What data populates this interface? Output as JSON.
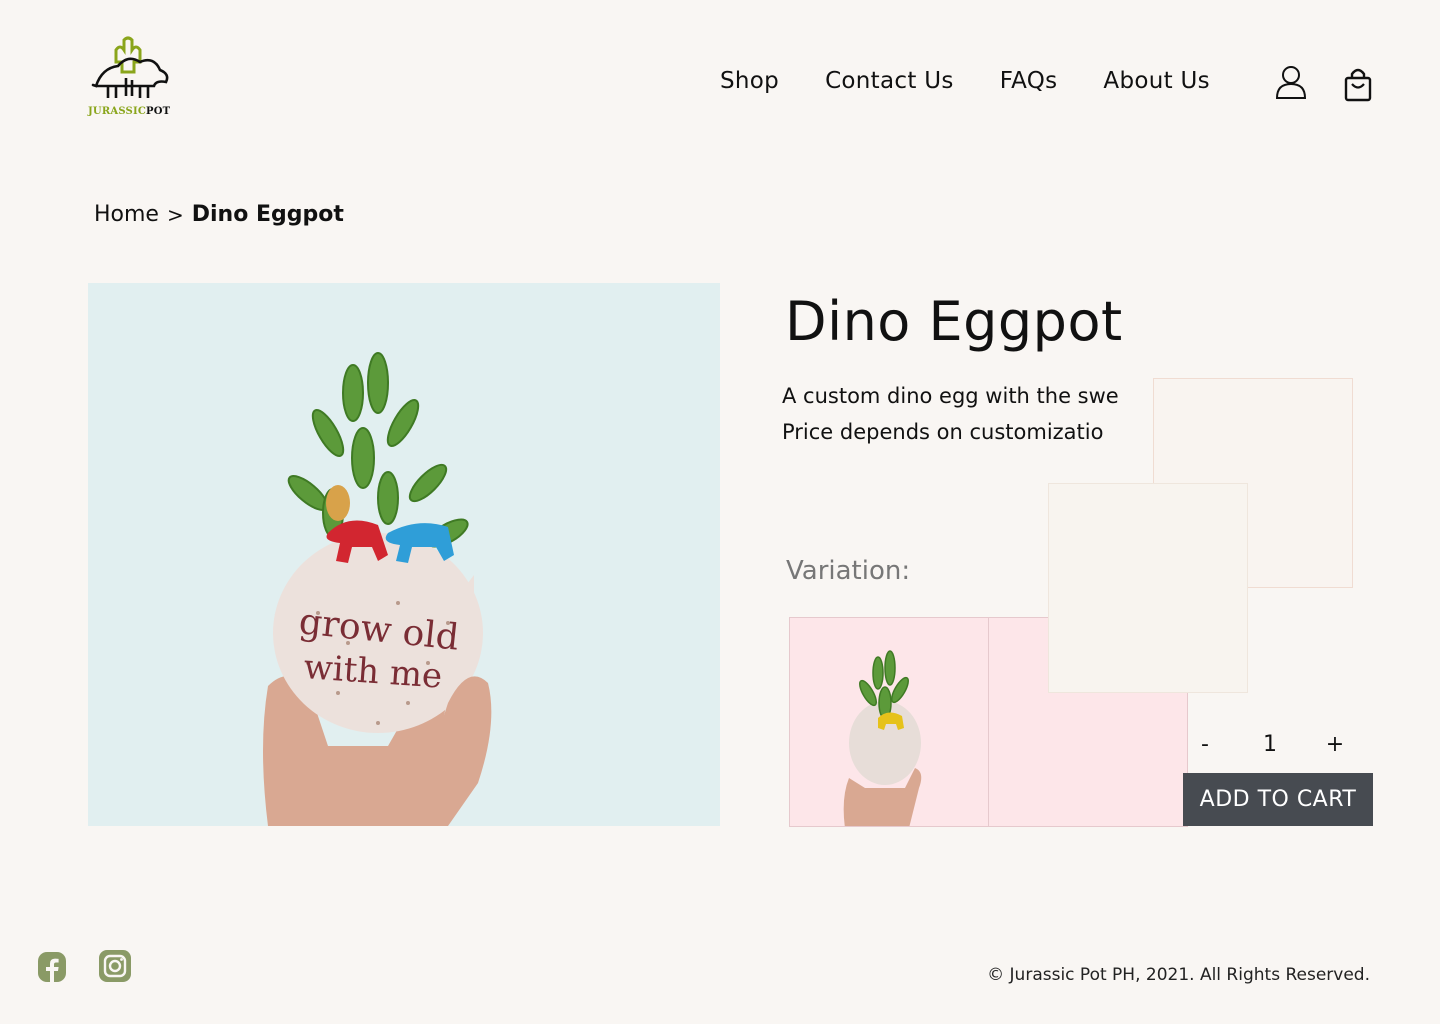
{
  "brand": {
    "logo_text_green": "JURASSIC",
    "logo_text_dark": "POT",
    "accent": "#8aa51b"
  },
  "nav": {
    "items": [
      {
        "label": "Shop"
      },
      {
        "label": "Contact Us"
      },
      {
        "label": "FAQs"
      },
      {
        "label": "About Us"
      }
    ],
    "user_icon": "user-icon",
    "cart_icon": "shopping-bag-icon"
  },
  "breadcrumb": {
    "home": "Home",
    "separator": ">",
    "current": "Dino Eggpot"
  },
  "product": {
    "title": "Dino Eggpot",
    "description_line1": "A custom dino egg with the swe",
    "description_line2": "Price depends on customizatio",
    "variation_label": "Variation:",
    "quantity": "1",
    "decrement_label": "-",
    "increment_label": "+",
    "add_to_cart_label": "ADD TO CART",
    "image_background": "#e1eff0",
    "swatch_background": "#fde6e9",
    "button_color": "#474b51"
  },
  "footer": {
    "copyright": "© Jurassic Pot PH, 2021. All Rights Reserved.",
    "social": [
      "facebook-icon",
      "instagram-icon"
    ],
    "social_color": "#8a9a66"
  }
}
